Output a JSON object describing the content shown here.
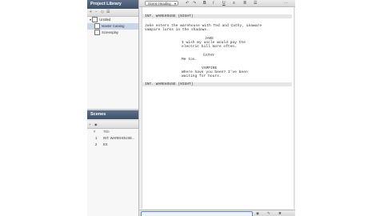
{
  "project_library": {
    "title": "Project Library",
    "toolbar_icons": [
      "+",
      "−",
      "◇",
      "☰"
    ],
    "tree": [
      {
        "label": "Untitled",
        "icon": "project-icon"
      },
      {
        "label": "Master Catalog",
        "icon": "catalog-icon"
      },
      {
        "label": "Screenplay",
        "icon": "screenplay-icon"
      }
    ]
  },
  "scenes": {
    "title": "Scenes",
    "toolbar_icons": [
      "+",
      "◉"
    ],
    "column_number": "#",
    "column_title": "Title",
    "rows": [
      {
        "number": "1",
        "title": "INT. WAREHOUSE..."
      },
      {
        "number": "2",
        "title": "EX"
      }
    ]
  },
  "toolbar": {
    "element_select": "Scene Heading",
    "icons": [
      "↶",
      "↷",
      "B",
      "I",
      "U",
      "≡",
      "≣",
      "☰",
      "⋯"
    ]
  },
  "script": {
    "heading1": "INT. WAREHOUSE (NIGHT)",
    "action1_line1": "Jake enters the warehouse with Ted and Cathy, unaware",
    "action1_line2": "vampire lurks in the shadows.",
    "char1": "JAKE",
    "dialogue1_line1": "I wish my uncle would pay the",
    "dialogue1_line2": "electric bill more often.",
    "char2": "CATHY",
    "dialogue2": "Me too.",
    "char3": "VAMPIRE",
    "dialogue3_line1": "Where have you been? I've been",
    "dialogue3_line2": "waiting for hours.",
    "heading2": "INT. WAREHOUSE (NIGHT)"
  },
  "statusbar": {
    "icons": [
      "◉",
      "✎",
      "✖"
    ]
  }
}
